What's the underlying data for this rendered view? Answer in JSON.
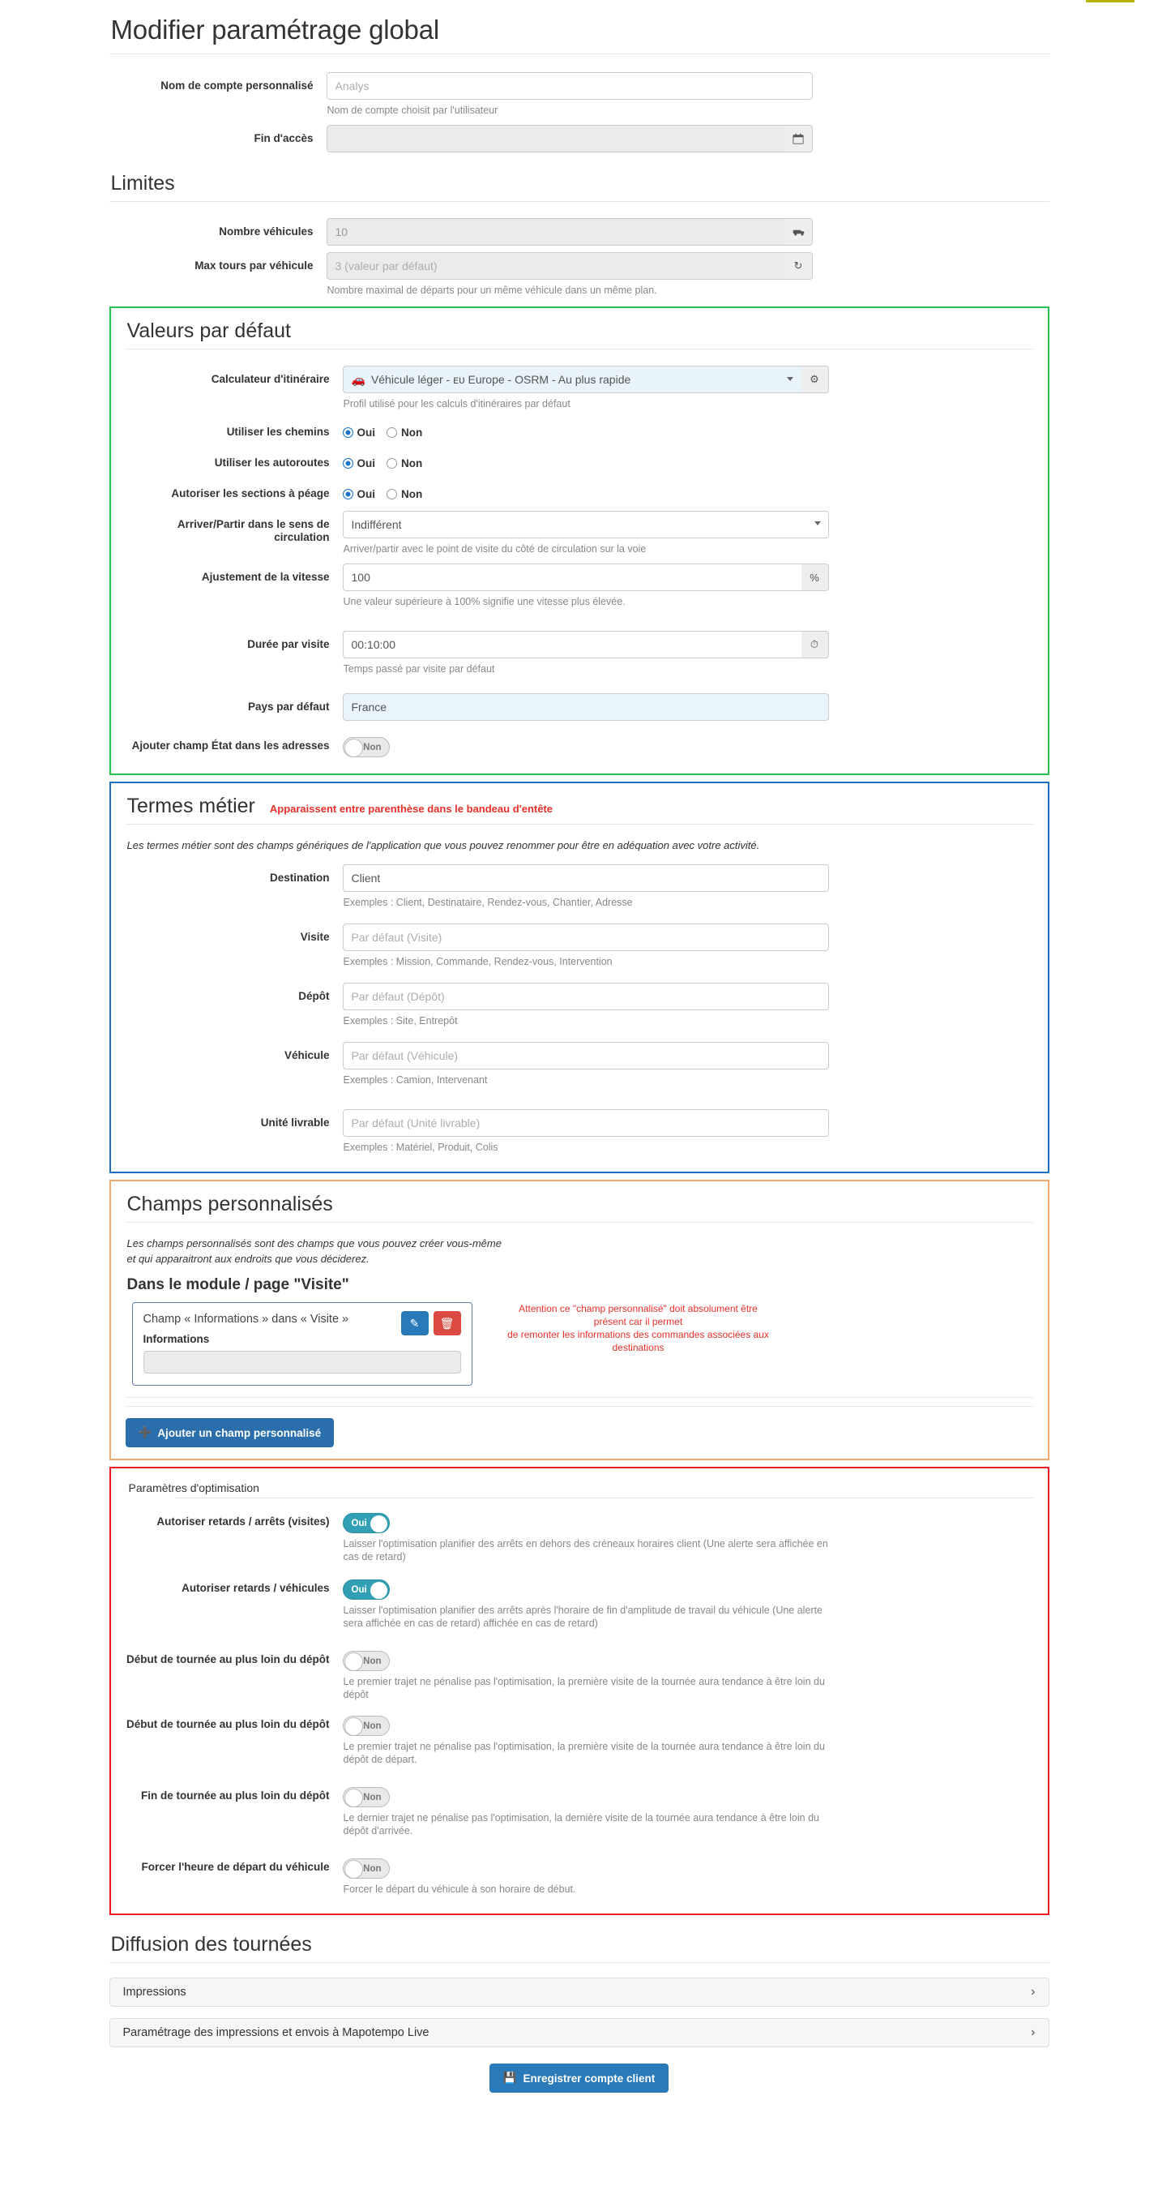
{
  "page": {
    "title": "Modifier paramétrage global"
  },
  "account": {
    "name_label": "Nom de compte personnalisé",
    "name_placeholder": "Analys",
    "name_help": "Nom de compte choisit par l'utilisateur",
    "access_end_label": "Fin d'accès",
    "access_end_value": "",
    "calendar_icon": "calendar-icon"
  },
  "limits": {
    "heading": "Limites",
    "vehicles_label": "Nombre véhicules",
    "vehicles_value": "10",
    "vehicles_icon": "vehicles-icon",
    "max_tours_label": "Max tours par véhicule",
    "max_tours_placeholder": "3 (valeur par défaut)",
    "max_tours_icon": "refresh-icon",
    "max_tours_help": "Nombre maximal de départs pour un même véhicule dans un même plan."
  },
  "defaults": {
    "heading": "Valeurs par défaut",
    "router_label": "Calculateur d'itinéraire",
    "router_value": "Véhicule léger - ᴇᴜ Europe - OSRM - Au plus rapide",
    "router_help": "Profil utilisé pour les calculs d'itinéraires par défaut",
    "router_gear_icon": "gear-icon",
    "tracks_label": "Utiliser les chemins",
    "motorway_label": "Utiliser les autoroutes",
    "toll_label": "Autoriser les sections à péage",
    "yes": "Oui",
    "no": "Non",
    "tracks_selected": "Oui",
    "motorway_selected": "Oui",
    "toll_selected": "Oui",
    "side_label": "Arriver/Partir dans le sens de circulation",
    "side_value": "Indifférent",
    "side_help": "Arriver/partir avec le point de visite du côté de circulation sur la voie",
    "speed_label": "Ajustement de la vitesse",
    "speed_value": "100",
    "speed_unit": "%",
    "speed_help": "Une valeur supérieure à 100% signifie une vitesse plus élevée.",
    "visit_duration_label": "Durée par visite",
    "visit_duration_value": "00:10:00",
    "visit_duration_icon": "clock-icon",
    "visit_duration_help": "Temps passé par visite par défaut",
    "country_label": "Pays par défaut",
    "country_value": "France",
    "state_field_label": "Ajouter champ État dans les adresses",
    "state_field_value": "Non"
  },
  "business_terms": {
    "heading": "Termes métier",
    "heading_note": "Apparaissent entre parenthèse dans le bandeau d'entête",
    "intro": "Les termes métier sont des champs génériques de l'application que vous pouvez renommer pour être en adéquation avec votre activité.",
    "rows": [
      {
        "label": "Destination",
        "value": "Client",
        "placeholder": "",
        "help": "Exemples : Client, Destinataire, Rendez-vous, Chantier, Adresse"
      },
      {
        "label": "Visite",
        "value": "",
        "placeholder": "Par défaut (Visite)",
        "help": "Exemples : Mission, Commande, Rendez-vous, Intervention"
      },
      {
        "label": "Dépôt",
        "value": "",
        "placeholder": "Par défaut (Dépôt)",
        "help": "Exemples : Site, Entrepôt"
      },
      {
        "label": "Véhicule",
        "value": "",
        "placeholder": "Par défaut (Véhicule)",
        "help": "Exemples : Camion, Intervenant"
      },
      {
        "label": "Unité livrable",
        "value": "",
        "placeholder": "Par défaut (Unité livrable)",
        "help": "Exemples : Matériel, Produit, Colis"
      }
    ]
  },
  "custom_fields": {
    "heading": "Champs personnalisés",
    "intro_line1": "Les champs personnalisés sont des champs que vous pouvez créer vous-même",
    "intro_line2": "et qui apparaitront aux endroits que vous déciderez.",
    "module_title": "Dans le module / page \"Visite\"",
    "card_title": "Champ « Informations » dans « Visite »",
    "card_sub": "Informations",
    "edit_icon": "edit-icon",
    "delete_icon": "trash-icon",
    "warning_line1": "Attention ce \"champ personnalisé\" doit absolument être présent car il permet",
    "warning_line2": "de remonter les informations des commandes associées aux destinations",
    "add_button": "Ajouter un champ personnalisé",
    "add_icon": "plus-icon"
  },
  "optimization": {
    "legend": "Paramètres d'optimisation",
    "rows": [
      {
        "label": "Autoriser retards / arrêts (visites)",
        "state": "Oui",
        "on": true,
        "help": "Laisser l'optimisation planifier des arrêts en dehors des créneaux horaires client (Une alerte sera affichée en cas de retard)"
      },
      {
        "label": "Autoriser retards / véhicules",
        "state": "Oui",
        "on": true,
        "help": "Laisser l'optimisation planifier des arrêts après l'horaire de fin d'amplitude de travail du véhicule (Une alerte sera affichée en cas de retard) affichée en cas de retard)"
      },
      {
        "label": "Début de tournée au plus loin du dépôt",
        "state": "Non",
        "on": false,
        "help": "Le premier trajet ne pénalise pas l'optimisation, la première visite de la tournée aura tendance à être loin du dépôt"
      },
      {
        "label": "Début de tournée au plus loin du dépôt",
        "state": "Non",
        "on": false,
        "help": "Le premier trajet ne pénalise pas l'optimisation, la première visite de la tournée aura tendance à être loin du dépôt de départ."
      },
      {
        "label": "Fin de tournée au plus loin du dépôt",
        "state": "Non",
        "on": false,
        "help": "Le dernier trajet ne pénalise pas l'optimisation, la dernière visite de la tournée aura tendance à être loin du dépôt d'arrivée."
      },
      {
        "label": "Forcer l'heure de départ du véhicule",
        "state": "Non",
        "on": false,
        "help": "Forcer le départ du véhicule à son horaire de début."
      }
    ]
  },
  "diffusion": {
    "heading": "Diffusion des tournées",
    "items": [
      {
        "label": "Impressions",
        "chevron": "chevron-right-icon"
      },
      {
        "label": "Paramétrage des impressions et envois à Mapotempo Live",
        "chevron": "chevron-right-icon"
      }
    ]
  },
  "footer": {
    "save_label": "Enregistrer compte client",
    "save_icon": "save-icon"
  }
}
